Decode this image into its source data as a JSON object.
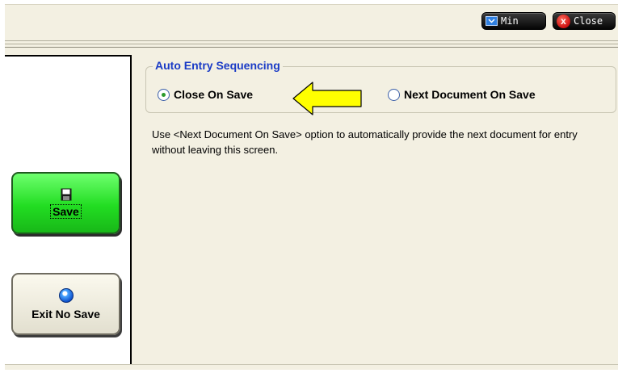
{
  "titlebar": {
    "min_label": "Min",
    "close_label": "Close",
    "close_glyph": "x"
  },
  "sidebar": {
    "save_label": "Save",
    "exit_label": "Exit No Save"
  },
  "auto_entry": {
    "title": "Auto Entry Sequencing",
    "options": [
      {
        "label": "Close On Save",
        "selected": true
      },
      {
        "label": "Next Document On Save",
        "selected": false
      }
    ],
    "help_text": "Use <Next Document On Save> option to automatically provide the next document for entry without leaving this screen."
  },
  "colors": {
    "accent_title": "#1a3bc6",
    "save_green": "#22dd22",
    "arrow_yellow": "#ffff00",
    "background": "#f3f0e2"
  },
  "icons": {
    "min": "minimize-icon",
    "close": "close-icon",
    "save": "floppy-disk-icon",
    "exit": "blue-orb-icon",
    "pointer": "yellow-arrow-icon"
  }
}
